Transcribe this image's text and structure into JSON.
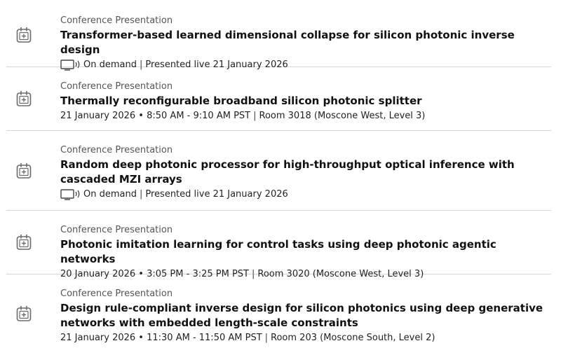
{
  "items": [
    {
      "type": "Conference Presentation",
      "title": "Transformer-based learned dimensional collapse for silicon photonic inverse design",
      "on_demand": "On demand",
      "presented": "Presented live 21 January 2026"
    },
    {
      "type": "Conference Presentation",
      "title": "Thermally reconfigurable broadband silicon photonic splitter",
      "schedule": "21 January 2026 • 8:50 AM - 9:10 AM PST",
      "room": "Room 3018 (Moscone West, Level 3)"
    },
    {
      "type": "Conference Presentation",
      "title": "Random deep photonic processor for high-throughput optical inference with cascaded MZI arrays",
      "on_demand": "On demand",
      "presented": "Presented live 21 January 2026"
    },
    {
      "type": "Conference Presentation",
      "title": "Photonic imitation learning for control tasks using deep photonic agentic networks",
      "schedule": "20 January 2026 • 3:05 PM - 3:25 PM PST",
      "room": "Room 3020 (Moscone West, Level 3)"
    },
    {
      "type": "Conference Presentation",
      "title": "Design rule-compliant inverse design for silicon photonics using deep generative networks with embedded length-scale constraints",
      "schedule": "21 January 2026 • 11:30 AM - 11:50 AM PST",
      "room": "Room 203 (Moscone South, Level 2)"
    }
  ],
  "separator": "|",
  "icons": {
    "add": "calendar-add-icon",
    "on_demand": "monitor-sound-icon"
  },
  "colors": {
    "divider": "#d6d6d6",
    "muted_text": "#555555",
    "title_text": "#111111"
  }
}
